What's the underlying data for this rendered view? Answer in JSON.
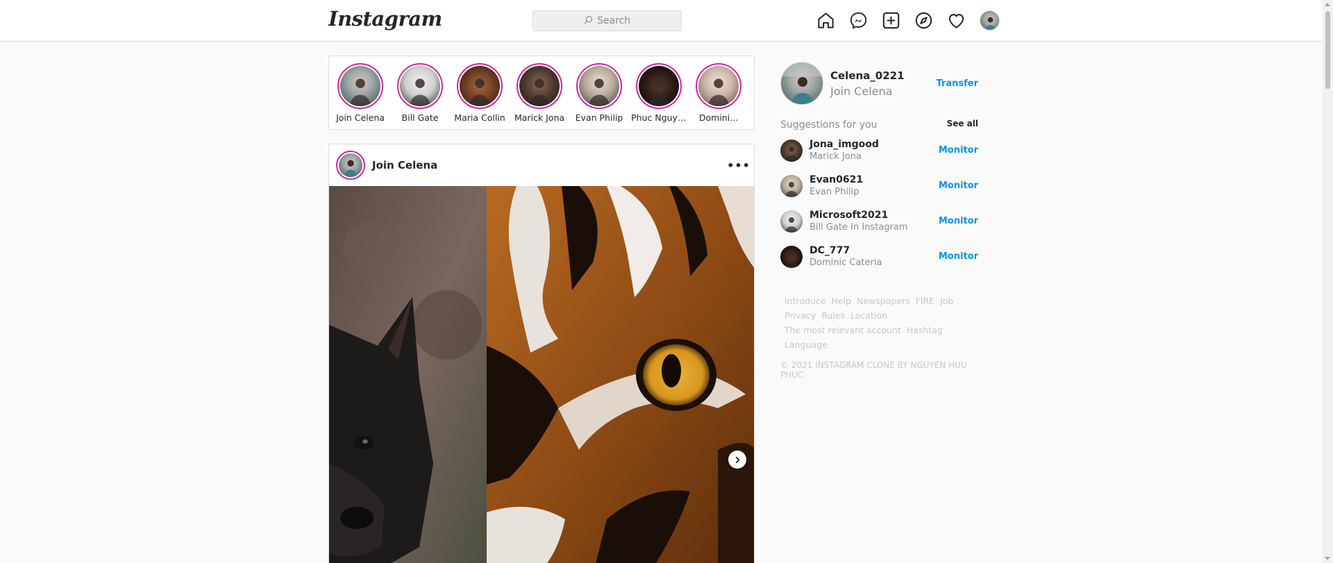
{
  "header": {
    "logo": "Instagram",
    "search_placeholder": "Search",
    "icons": [
      "home-icon",
      "messenger-icon",
      "new-post-icon",
      "explore-icon",
      "activity-heart-icon",
      "profile-avatar"
    ]
  },
  "stories": [
    {
      "name": "Join Celena"
    },
    {
      "name": "Bill Gate"
    },
    {
      "name": "Maria Collin"
    },
    {
      "name": "Marick Jona"
    },
    {
      "name": "Evan Philip"
    },
    {
      "name": "Phuc Nguyen"
    },
    {
      "name": "Domini..."
    }
  ],
  "post": {
    "username": "Join Celena",
    "more_label": "•••"
  },
  "sidebar": {
    "me": {
      "username": "Celena_0221",
      "fullname": "Join Celena",
      "action": "Transfer"
    },
    "suggestions_title": "Suggestions for you",
    "see_all": "See all",
    "suggestions": [
      {
        "username": "Jona_imgood",
        "fullname": "Marick Jona",
        "action": "Monitor"
      },
      {
        "username": "Evan0621",
        "fullname": "Evan Philip",
        "action": "Monitor"
      },
      {
        "username": "Microsoft2021",
        "fullname": "Bill Gate In Instagram",
        "action": "Monitor"
      },
      {
        "username": "DC_777",
        "fullname": "Dominic Cateria",
        "action": "Monitor"
      }
    ],
    "footer_links": [
      "Introduce",
      "Help",
      "Newspapers",
      "FIRE",
      "Job",
      "Privacy",
      "Rules",
      "Location",
      "The most relevant account",
      "Hashtag",
      "Language"
    ],
    "copyright": "© 2021 INSTAGRAM CLONE BY NGUYEN HUU PHUC"
  },
  "colors": {
    "accent": "#0095f6",
    "story_ring": "#d6249f",
    "border": "#dbdbdb",
    "muted": "#8e8e8e"
  }
}
